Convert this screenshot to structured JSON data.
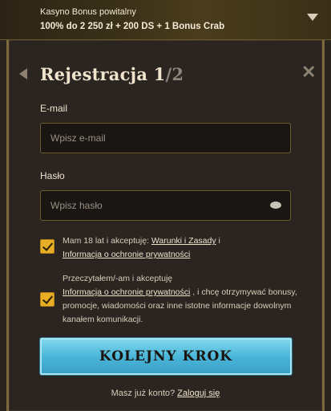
{
  "bonus": {
    "title": "Kasyno Bonus powitalny",
    "description": "100% do 2 250 zł + 200 DS + 1 Bonus Crab"
  },
  "form": {
    "title_main": "Rejestracja 1",
    "title_sep": "/2",
    "email_label": "E-mail",
    "email_placeholder": "Wpisz e-mail",
    "password_label": "Hasło",
    "password_placeholder": "Wpisz hasło",
    "consent1_text": "Mam 18 lat i akceptuję: ",
    "consent1_link1": "Warunki i Zasady",
    "consent1_sep": " i ",
    "consent1_link2": "Informacja o ochronie prywatności",
    "consent2_text1": "Przeczytałem/-am i akceptuję ",
    "consent2_link": "Informacja o ochronie prywatności",
    "consent2_text2": ", i chcę otrzymywać bonusy, promocje, wiadomości oraz inne istotne informacje dowolnym kanałem komunikacji.",
    "submit_label": "KOLEJNY KROK",
    "login_prompt": "Masz już konto? ",
    "login_link": "Zaloguj się"
  },
  "colors": {
    "accent_gold": "#e7ae25",
    "button_blue": "#4bb6d9"
  },
  "icons": [
    "chevron-down-icon",
    "back-arrow-icon",
    "close-icon",
    "eye-icon",
    "checkmark-icon"
  ]
}
